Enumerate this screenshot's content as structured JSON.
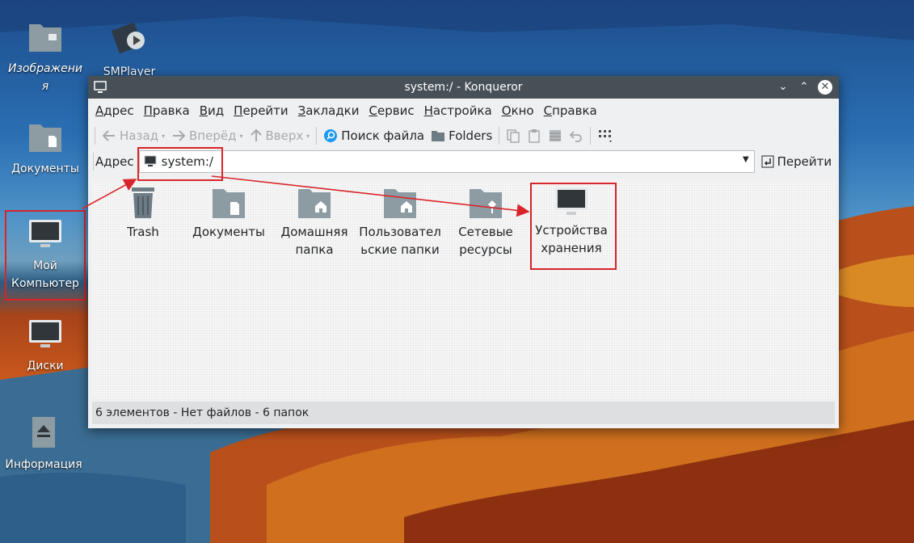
{
  "desktop": {
    "icons": [
      {
        "label": "Изображения",
        "icon": "folder-image-icon"
      },
      {
        "label": "SMPlayer",
        "icon": "smplayer-icon"
      },
      {
        "label": "Документы",
        "icon": "folder-document-icon"
      },
      {
        "label": "Мой Компьютер",
        "icon": "computer-icon"
      },
      {
        "label": "Диски",
        "icon": "monitor-icon"
      },
      {
        "label": "Информация",
        "icon": "eject-icon"
      }
    ]
  },
  "window": {
    "title": "system:/ - Konqueror",
    "menu": [
      "Адрес",
      "Правка",
      "Вид",
      "Перейти",
      "Закладки",
      "Сервис",
      "Настройка",
      "Окно",
      "Справка"
    ],
    "toolbar": {
      "back": "Назад",
      "forward": "Вперёд",
      "up": "Вверх",
      "find": "Поиск файла",
      "folders": "Folders"
    },
    "address": {
      "label": "Адрес",
      "value": "system:/",
      "go": "Перейти"
    },
    "items": [
      {
        "label": "Trash",
        "icon": "trash-icon"
      },
      {
        "label": "Документы",
        "icon": "folder-document-icon"
      },
      {
        "label": "Домашняя папка",
        "icon": "folder-home-icon"
      },
      {
        "label": "Пользовательские папки",
        "icon": "folder-home-icon"
      },
      {
        "label": "Сетевые ресурсы",
        "icon": "folder-network-icon"
      },
      {
        "label": "Устройства хранения ...",
        "icon": "monitor-icon"
      }
    ],
    "status": "6 элементов - Нет файлов - 6 папок"
  },
  "colors": {
    "highlight": "#d9252a",
    "titlebar": "#475057",
    "folder": "#8d9ba3"
  }
}
